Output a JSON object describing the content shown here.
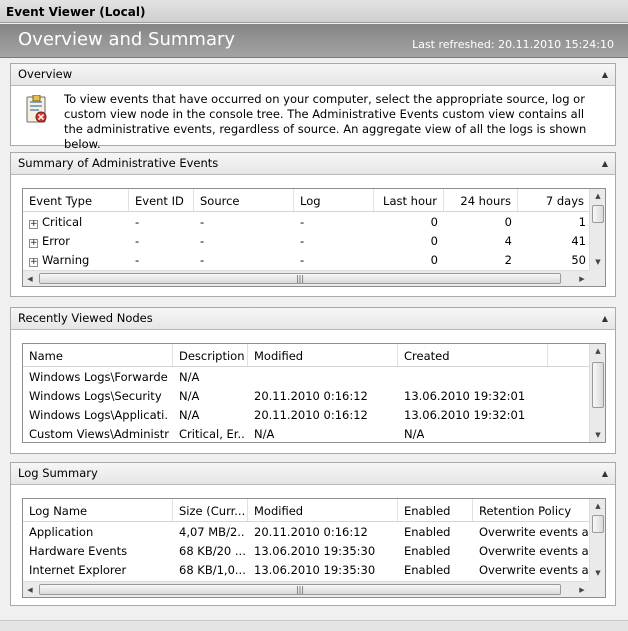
{
  "window": {
    "title": "Event Viewer (Local)"
  },
  "header": {
    "title": "Overview and Summary",
    "last_refreshed": "Last refreshed: 20.11.2010 15:24:10"
  },
  "overview": {
    "title": "Overview",
    "text": "To view events that have occurred on your computer, select the appropriate source, log or custom view node in the console tree. The Administrative Events custom view contains all the administrative events, regardless of source. An aggregate view of all the logs is shown below."
  },
  "summary": {
    "title": "Summary of Administrative Events",
    "columns": [
      "Event Type",
      "Event ID",
      "Source",
      "Log",
      "Last hour",
      "24 hours",
      "7 days"
    ],
    "rows": [
      [
        "Critical",
        "-",
        "-",
        "-",
        "0",
        "0",
        "1"
      ],
      [
        "Error",
        "-",
        "-",
        "-",
        "0",
        "4",
        "41"
      ],
      [
        "Warning",
        "-",
        "-",
        "-",
        "0",
        "2",
        "50"
      ]
    ]
  },
  "recent": {
    "title": "Recently Viewed Nodes",
    "columns": [
      "Name",
      "Description",
      "Modified",
      "Created"
    ],
    "rows": [
      [
        "Windows Logs\\Forwarde...",
        "N/A",
        "",
        ""
      ],
      [
        "Windows Logs\\Security",
        "N/A",
        "20.11.2010 0:16:12",
        "13.06.2010 19:32:01"
      ],
      [
        "Windows Logs\\Applicati...",
        "N/A",
        "20.11.2010 0:16:12",
        "13.06.2010 19:32:01"
      ],
      [
        "Custom Views\\Administr...",
        "Critical, Er...",
        "N/A",
        "N/A"
      ]
    ]
  },
  "logsummary": {
    "title": "Log Summary",
    "columns": [
      "Log Name",
      "Size (Curr...",
      "Modified",
      "Enabled",
      "Retention Policy"
    ],
    "rows": [
      [
        "Application",
        "4,07 MB/2...",
        "20.11.2010 0:16:12",
        "Enabled",
        "Overwrite events as n"
      ],
      [
        "Hardware Events",
        "68 KB/20 ...",
        "13.06.2010 19:35:30",
        "Enabled",
        "Overwrite events as n"
      ],
      [
        "Internet Explorer",
        "68 KB/1,0...",
        "13.06.2010 19:35:30",
        "Enabled",
        "Overwrite events as n"
      ]
    ]
  },
  "icons": {
    "collapse": "▲",
    "scroll_up": "▲",
    "scroll_down": "▼",
    "scroll_left": "◀",
    "scroll_right": "▶",
    "expand": "+",
    "grip": "|||"
  },
  "colors": {
    "header_bg": "#939393",
    "section_border": "#a9a9a9"
  }
}
